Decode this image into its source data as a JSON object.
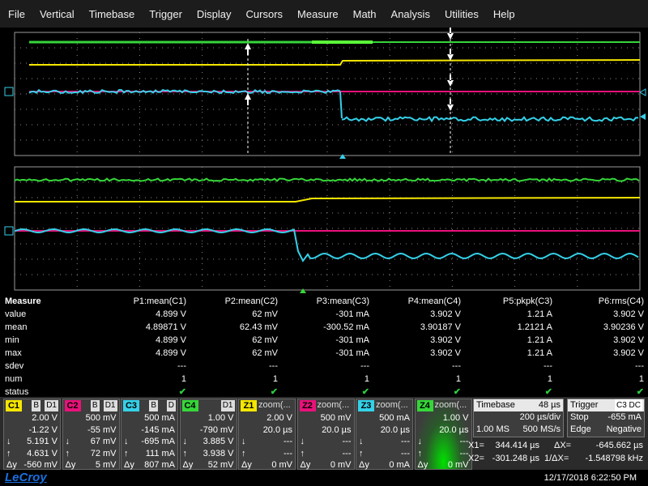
{
  "menu": [
    "File",
    "Vertical",
    "Timebase",
    "Trigger",
    "Display",
    "Cursors",
    "Measure",
    "Math",
    "Analysis",
    "Utilities",
    "Help"
  ],
  "measure": {
    "title": "Measure",
    "columns": [
      "P1:mean(C1)",
      "P2:mean(C2)",
      "P3:mean(C3)",
      "P4:mean(C4)",
      "P5:pkpk(C3)",
      "P6:rms(C4)"
    ],
    "rows": [
      {
        "label": "value",
        "cells": [
          "4.899 V",
          "62 mV",
          "-301 mA",
          "3.902 V",
          "1.21 A",
          "3.902 V"
        ]
      },
      {
        "label": "mean",
        "cells": [
          "4.89871 V",
          "62.43 mV",
          "-300.52 mA",
          "3.90187 V",
          "1.2121 A",
          "3.90236 V"
        ]
      },
      {
        "label": "min",
        "cells": [
          "4.899 V",
          "62 mV",
          "-301 mA",
          "3.902 V",
          "1.21 A",
          "3.902 V"
        ]
      },
      {
        "label": "max",
        "cells": [
          "4.899 V",
          "62 mV",
          "-301 mA",
          "3.902 V",
          "1.21 A",
          "3.902 V"
        ]
      },
      {
        "label": "sdev",
        "cells": [
          "---",
          "---",
          "---",
          "---",
          "---",
          "---"
        ]
      },
      {
        "label": "num",
        "cells": [
          "1",
          "1",
          "1",
          "1",
          "1",
          "1"
        ]
      },
      {
        "label": "status",
        "cells": [
          "✔",
          "✔",
          "✔",
          "✔",
          "✔",
          "✔"
        ]
      }
    ]
  },
  "channels": [
    {
      "tag": "C1",
      "color": "#f5e600",
      "b1": "B",
      "b2": "D1",
      "rows": [
        [
          "",
          "2.00 V"
        ],
        [
          "",
          "-1.22 V"
        ],
        [
          "↓",
          "5.191 V"
        ],
        [
          "↑",
          "4.631 V"
        ],
        [
          "Δy",
          "-560 mV"
        ]
      ]
    },
    {
      "tag": "C2",
      "color": "#e8127a",
      "b1": "B",
      "b2": "D1",
      "rows": [
        [
          "",
          "500 mV"
        ],
        [
          "",
          "-55 mV"
        ],
        [
          "↓",
          "67 mV"
        ],
        [
          "↑",
          "72 mV"
        ],
        [
          "Δy",
          "5 mV"
        ]
      ]
    },
    {
      "tag": "C3",
      "color": "#35d0e8",
      "b1": "B",
      "b2": "D",
      "rows": [
        [
          "",
          "500 mA"
        ],
        [
          "",
          "-145 mA"
        ],
        [
          "↓",
          "-695 mA"
        ],
        [
          "↑",
          "111 mA"
        ],
        [
          "Δy",
          "807 mA"
        ]
      ]
    },
    {
      "tag": "C4",
      "color": "#36d63a",
      "b1": "",
      "b2": "D1",
      "rows": [
        [
          "",
          "1.00 V"
        ],
        [
          "",
          "-790 mV"
        ],
        [
          "↓",
          "3.885 V"
        ],
        [
          "↑",
          "3.938 V"
        ],
        [
          "Δy",
          "52 mV"
        ]
      ]
    },
    {
      "tag": "Z1",
      "color": "#f5e600",
      "title": "zoom(...",
      "rows": [
        [
          "",
          "2.00 V"
        ],
        [
          "",
          "20.0 µs"
        ],
        [
          "↓",
          "---"
        ],
        [
          "↑",
          "---"
        ],
        [
          "Δy",
          "0 mV"
        ]
      ]
    },
    {
      "tag": "Z2",
      "color": "#e8127a",
      "title": "zoom(...",
      "rows": [
        [
          "",
          "500 mV"
        ],
        [
          "",
          "20.0 µs"
        ],
        [
          "↓",
          "---"
        ],
        [
          "↑",
          "---"
        ],
        [
          "Δy",
          "0 mV"
        ]
      ]
    },
    {
      "tag": "Z3",
      "color": "#35d0e8",
      "title": "zoom(...",
      "rows": [
        [
          "",
          "500 mA"
        ],
        [
          "",
          "20.0 µs"
        ],
        [
          "↓",
          "---"
        ],
        [
          "↑",
          "---"
        ],
        [
          "Δy",
          "0 mA"
        ]
      ]
    },
    {
      "tag": "Z4",
      "color": "#36d63a",
      "title": "zoom(...",
      "rows": [
        [
          "",
          "1.00 V"
        ],
        [
          "",
          "20.0 µs"
        ],
        [
          "↓",
          "---"
        ],
        [
          "↑",
          "---"
        ],
        [
          "Δy",
          "0 mV"
        ]
      ]
    }
  ],
  "timebase": {
    "title": "Timebase",
    "delay": "48 µs",
    "div": "200 µs/div",
    "samples": "1.00 MS",
    "rate": "500 MS/s"
  },
  "trigger": {
    "title": "Trigger",
    "badge": "C3 DC",
    "mode": "Stop",
    "level": "-655 mA",
    "type": "Edge",
    "slope": "Negative"
  },
  "cursors": {
    "x1_label": "X1=",
    "x1": "344.414 µs",
    "dx_label": "ΔX=",
    "dx": "-645.662 µs",
    "x2_label": "X2=",
    "x2": "-301.248 µs",
    "inv_label": "1/ΔX=",
    "inv": "-1.548798 kHz"
  },
  "footer": {
    "logo": "LeCroy",
    "datetime": "12/17/2018 6:22:50 PM"
  },
  "colors": {
    "c1": "#f5e600",
    "c2": "#e8127a",
    "c3": "#35d0e8",
    "c4": "#36d63a"
  }
}
